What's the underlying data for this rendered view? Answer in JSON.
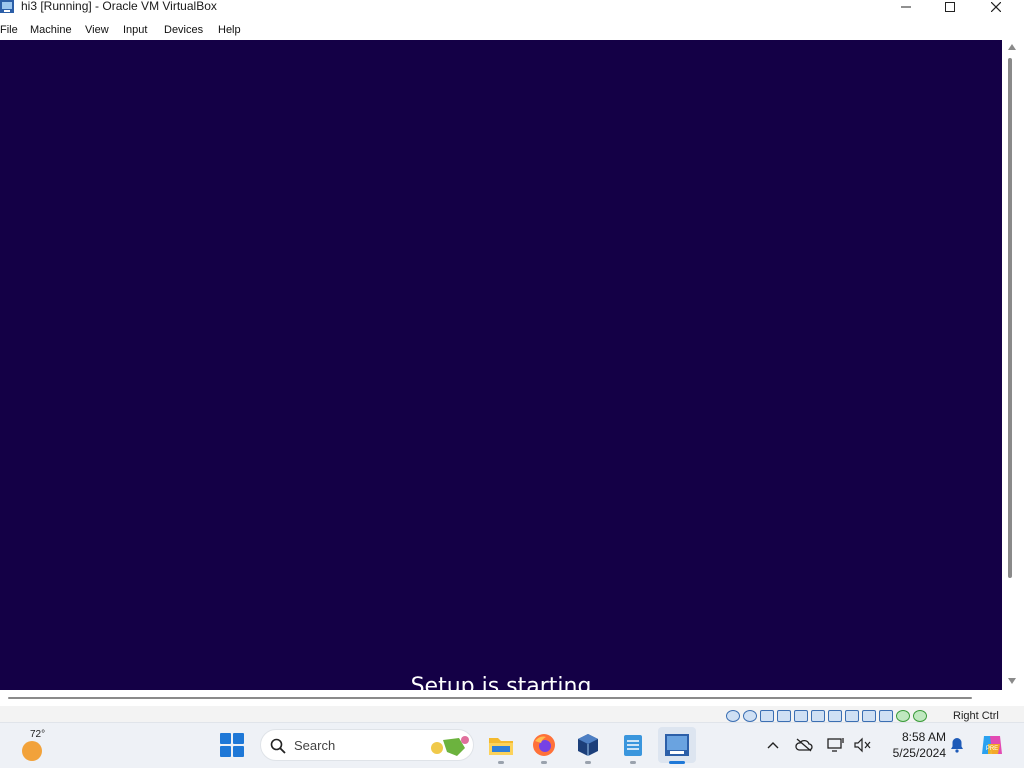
{
  "window": {
    "title": "hi3 [Running] - Oracle VM VirtualBox"
  },
  "menu": {
    "items": [
      "File",
      "Machine",
      "View",
      "Input",
      "Devices",
      "Help"
    ]
  },
  "vm": {
    "status_text": "Setup is starting",
    "background_color": "#140046"
  },
  "statusbar": {
    "host_key": "Right Ctrl"
  },
  "taskbar": {
    "weather_temp": "72°",
    "search_placeholder": "Search",
    "apps": [
      "file-explorer",
      "firefox",
      "virtualbox",
      "notepad",
      "vm-window"
    ],
    "time": "8:58 AM",
    "date": "5/25/2024"
  },
  "colors": {
    "accent": "#1e78d7",
    "vm_bg": "#140046"
  }
}
